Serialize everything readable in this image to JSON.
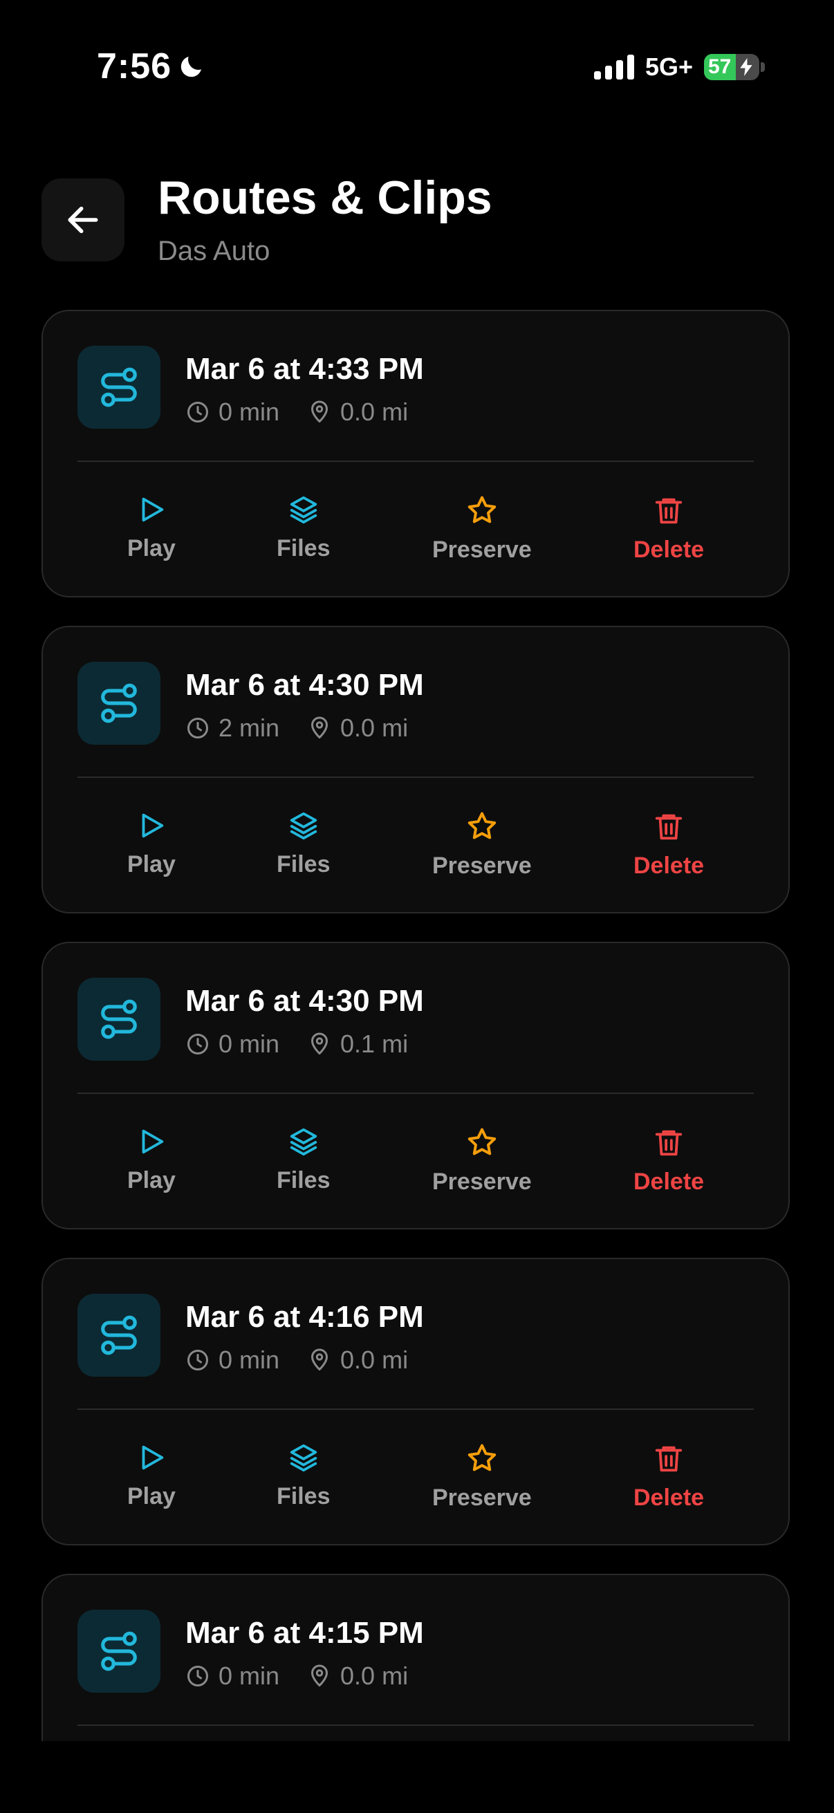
{
  "status_bar": {
    "time": "7:56",
    "network": "5G+",
    "battery_level": "57",
    "battery_fraction": 0.57
  },
  "header": {
    "title": "Routes & Clips",
    "subtitle": "Das Auto"
  },
  "colors": {
    "accent": "#22b8dc",
    "preserve": "#f59e0b",
    "delete": "#ef4444",
    "muted": "#8a8a8a"
  },
  "actions": {
    "play_label": "Play",
    "files_label": "Files",
    "preserve_label": "Preserve",
    "delete_label": "Delete"
  },
  "routes": [
    {
      "title": "Mar 6 at 4:33 PM",
      "duration": "0 min",
      "distance": "0.0 mi"
    },
    {
      "title": "Mar 6 at 4:30 PM",
      "duration": "2 min",
      "distance": "0.0 mi"
    },
    {
      "title": "Mar 6 at 4:30 PM",
      "duration": "0 min",
      "distance": "0.1 mi"
    },
    {
      "title": "Mar 6 at 4:16 PM",
      "duration": "0 min",
      "distance": "0.0 mi"
    },
    {
      "title": "Mar 6 at 4:15 PM",
      "duration": "0 min",
      "distance": "0.0 mi"
    }
  ]
}
